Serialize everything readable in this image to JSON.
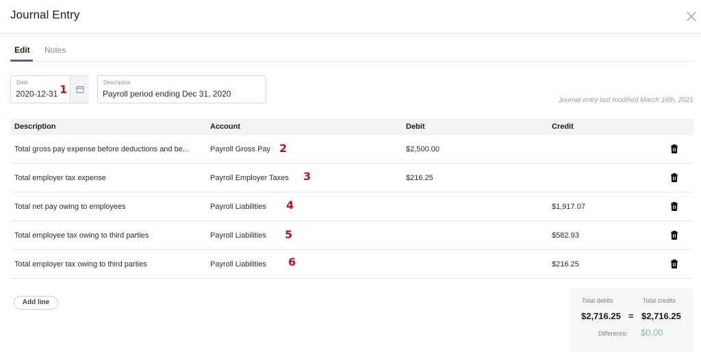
{
  "header": {
    "title": "Journal Entry",
    "close_icon": "close-icon"
  },
  "tabs": [
    {
      "label": "Edit",
      "active": true
    },
    {
      "label": "Notes",
      "active": false
    }
  ],
  "form": {
    "date": {
      "label": "Date",
      "value": "2020-12-31",
      "icon": "calendar-icon"
    },
    "description": {
      "label": "Description",
      "value": "Payroll period ending Dec 31, 2020"
    },
    "last_modified": "Journal entry last modified March 16th, 2021"
  },
  "annotations": [
    "1",
    "2",
    "3",
    "4",
    "5",
    "6"
  ],
  "table": {
    "columns": [
      "Description",
      "Account",
      "Debit",
      "Credit"
    ],
    "rows": [
      {
        "description": "Total gross pay expense before deductions and be...",
        "account": "Payroll Gross Pay",
        "debit": "$2,500.00",
        "credit": ""
      },
      {
        "description": "Total employer tax expense",
        "account": "Payroll Employer Taxes",
        "debit": "$216.25",
        "credit": ""
      },
      {
        "description": "Total net pay owing to employees",
        "account": "Payroll Liabilities",
        "debit": "",
        "credit": "$1,917.07"
      },
      {
        "description": "Total employee tax owing to third parties",
        "account": "Payroll Liabilities",
        "debit": "",
        "credit": "$582.93"
      },
      {
        "description": "Total employer tax owing to third parties",
        "account": "Payroll Liabilities",
        "debit": "",
        "credit": "$216.25"
      }
    ],
    "row_action_icon": "trash-icon"
  },
  "actions": {
    "add_line_label": "Add line"
  },
  "totals": {
    "debits_label": "Total debits",
    "credits_label": "Total credits",
    "debits_value": "$2,716.25",
    "equals": "=",
    "credits_value": "$2,716.25",
    "difference_label": "Difference:",
    "difference_value": "$0.00"
  },
  "colors": {
    "accent": "#3b66a3",
    "annotation": "#c1121f",
    "difference_ok": "#6fc59a"
  }
}
